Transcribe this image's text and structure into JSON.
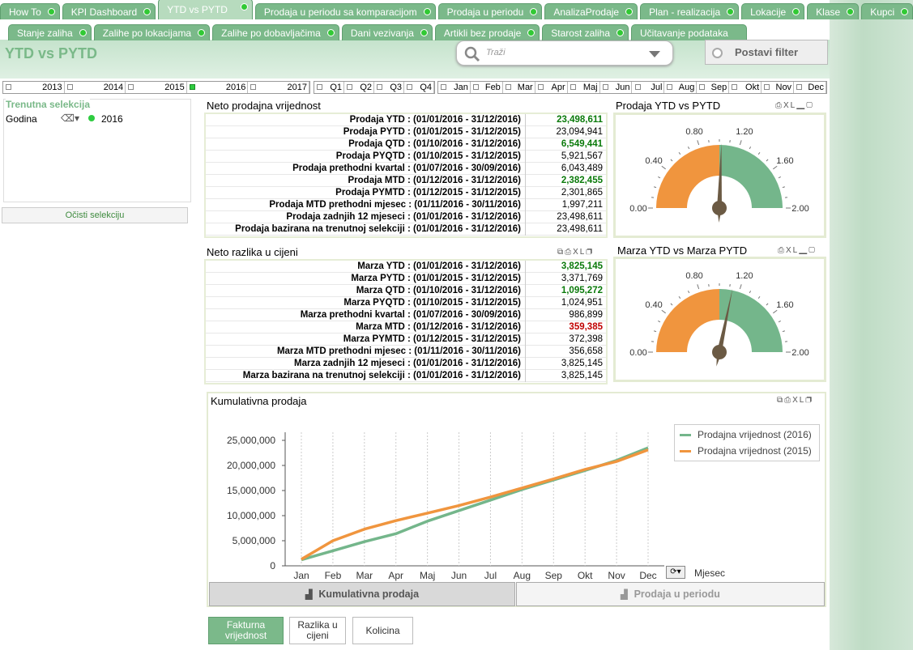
{
  "tabs_row1": [
    {
      "label": "How To",
      "active": false
    },
    {
      "label": "KPI Dashboard",
      "active": false
    },
    {
      "label": "YTD vs PYTD",
      "active": true
    },
    {
      "label": "Prodaja u periodu sa komparacijom",
      "active": false
    },
    {
      "label": "Prodaja u periodu",
      "active": false
    },
    {
      "label": "AnalizaProdaje",
      "active": false
    },
    {
      "label": "Plan - realizacija",
      "active": false
    },
    {
      "label": "Lokacije",
      "active": false
    },
    {
      "label": "Klase",
      "active": false
    },
    {
      "label": "Kupci",
      "active": false
    }
  ],
  "tabs_row2": [
    {
      "label": "Stanje zaliha"
    },
    {
      "label": "Zalihe po lokacijama"
    },
    {
      "label": "Zalihe po dobavljačima"
    },
    {
      "label": "Dani vezivanja"
    },
    {
      "label": "Artikli bez prodaje"
    },
    {
      "label": "Starost zaliha"
    },
    {
      "label": "Učitavanje podataka"
    }
  ],
  "page_title": "YTD vs PYTD",
  "search": {
    "placeholder": "Traži"
  },
  "filter_button": "Postavi filter",
  "years": [
    {
      "label": "2013",
      "selected": false
    },
    {
      "label": "2014",
      "selected": false
    },
    {
      "label": "2015",
      "selected": false
    },
    {
      "label": "2016",
      "selected": true
    },
    {
      "label": "2017",
      "selected": false
    }
  ],
  "quarters": [
    "Q1",
    "Q2",
    "Q3",
    "Q4"
  ],
  "months": [
    "Jan",
    "Feb",
    "Mar",
    "Apr",
    "Maj",
    "Jun",
    "Jul",
    "Aug",
    "Sep",
    "Okt",
    "Nov",
    "Dec"
  ],
  "current_selection": {
    "title": "Trenutna selekcija",
    "field": "Godina",
    "value": "2016",
    "clear_label": "Očisti selekciju"
  },
  "sales_table": {
    "title": "Neto prodajna vrijednost",
    "rows": [
      {
        "label": "Prodaja YTD : (01/01/2016 - 31/12/2016)",
        "value": "23,498,611",
        "color": "#0a7a0a"
      },
      {
        "label": "Prodaja PYTD : (01/01/2015 - 31/12/2015)",
        "value": "23,094,941",
        "color": "#000000"
      },
      {
        "label": "Prodaja QTD : (01/10/2016 - 31/12/2016)",
        "value": "6,549,441",
        "color": "#0a7a0a"
      },
      {
        "label": "Prodaja PYQTD : (01/10/2015 - 31/12/2015)",
        "value": "5,921,567",
        "color": "#000000"
      },
      {
        "label": "Prodaja prethodni kvartal : (01/07/2016 - 30/09/2016)",
        "value": "6,043,489",
        "color": "#000000"
      },
      {
        "label": "Prodaja MTD : (01/12/2016 - 31/12/2016)",
        "value": "2,382,455",
        "color": "#0a7a0a"
      },
      {
        "label": "Prodaja PYMTD : (01/12/2015 - 31/12/2015)",
        "value": "2,301,865",
        "color": "#000000"
      },
      {
        "label": "Prodaja MTD prethodni mjesec : (01/11/2016 - 30/11/2016)",
        "value": "1,997,211",
        "color": "#000000"
      },
      {
        "label": "Prodaja zadnjih 12 mjeseci : (01/01/2016 - 31/12/2016)",
        "value": "23,498,611",
        "color": "#000000"
      },
      {
        "label": "Prodaja bazirana na trenutnoj selekciji : (01/01/2016 - 31/12/2016)",
        "value": "23,498,611",
        "color": "#000000"
      }
    ]
  },
  "margin_table": {
    "title": "Neto razlika u cijeni",
    "rows": [
      {
        "label": "Marza YTD : (01/01/2016 - 31/12/2016)",
        "value": "3,825,145",
        "color": "#0a7a0a"
      },
      {
        "label": "Marza PYTD : (01/01/2015 - 31/12/2015)",
        "value": "3,371,769",
        "color": "#000000"
      },
      {
        "label": "Marza QTD : (01/10/2016 - 31/12/2016)",
        "value": "1,095,272",
        "color": "#0a7a0a"
      },
      {
        "label": "Marza PYQTD : (01/10/2015 - 31/12/2015)",
        "value": "1,024,951",
        "color": "#000000"
      },
      {
        "label": "Marza prethodni kvartal : (01/07/2016 - 30/09/2016)",
        "value": "986,899",
        "color": "#000000"
      },
      {
        "label": "Marza MTD : (01/12/2016 - 31/12/2016)",
        "value": "359,385",
        "color": "#c00000"
      },
      {
        "label": "Marza PYMTD : (01/12/2015 - 31/12/2015)",
        "value": "372,398",
        "color": "#000000"
      },
      {
        "label": "Marza MTD prethodni mjesec : (01/11/2016 - 30/11/2016)",
        "value": "356,658",
        "color": "#000000"
      },
      {
        "label": "Marza zadnjih 12 mjeseci : (01/01/2016 - 31/12/2016)",
        "value": "3,825,145",
        "color": "#000000"
      },
      {
        "label": "Marza bazirana na trenutnoj selekciji : (01/01/2016 - 31/12/2016)",
        "value": "3,825,145",
        "color": "#000000"
      }
    ]
  },
  "gauge_sales": {
    "title": "Prodaja YTD vs PYTD",
    "value": 1.02,
    "min": 0,
    "max": 2,
    "ticks": [
      "0.00",
      "0.40",
      "0.80",
      "1.20",
      "1.60",
      "2.00"
    ],
    "low_color": "#f0953e",
    "high_color": "#74b68b",
    "threshold": 1.0
  },
  "gauge_margin": {
    "title": "Marza YTD vs Marza PYTD",
    "value": 1.13,
    "min": 0,
    "max": 2,
    "ticks": [
      "0.00",
      "0.40",
      "0.80",
      "1.20",
      "1.60",
      "2.00"
    ],
    "low_color": "#f0953e",
    "high_color": "#74b68b",
    "threshold": 1.0
  },
  "chart_data": {
    "type": "line",
    "title": "Kumulativna prodaja",
    "xlabel": "Mjesec",
    "ylabel": "",
    "categories": [
      "Jan",
      "Feb",
      "Mar",
      "Apr",
      "Maj",
      "Jun",
      "Jul",
      "Aug",
      "Sep",
      "Okt",
      "Nov",
      "Dec"
    ],
    "ylim": [
      0,
      25000000
    ],
    "yticks": [
      "0",
      "5,000,000",
      "10,000,000",
      "15,000,000",
      "20,000,000",
      "25,000,000"
    ],
    "grid": true,
    "legend_position": "top-right",
    "series": [
      {
        "name": "Prodajna vrijednost (2016)",
        "color": "#74b68b",
        "values": [
          1200000,
          3000000,
          4800000,
          6400000,
          8900000,
          11000000,
          13100000,
          15200000,
          17100000,
          19000000,
          21000000,
          23500000
        ]
      },
      {
        "name": "Prodajna vrijednost (2015)",
        "color": "#f0953e",
        "values": [
          1300000,
          5000000,
          7300000,
          9000000,
          10500000,
          12000000,
          13700000,
          15500000,
          17300000,
          19200000,
          20800000,
          23100000
        ]
      }
    ]
  },
  "bottom_tabs": [
    "Kumulativna prodaja",
    "Prodaja u periodu"
  ],
  "measure_buttons": [
    "Fakturna vrijednost",
    "Razlika u cijeni",
    "Kolicina"
  ],
  "icons": {
    "print": "P",
    "xl": "XL"
  }
}
